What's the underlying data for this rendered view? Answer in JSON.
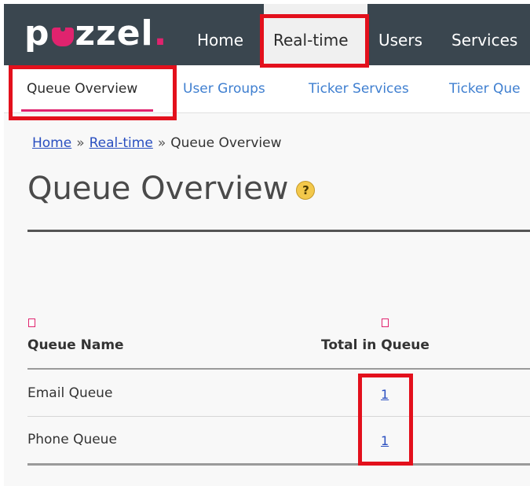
{
  "brand": {
    "logo_start": "p",
    "logo_end": "zzel",
    "logo_dot": "."
  },
  "nav": {
    "items": [
      {
        "label": "Home"
      },
      {
        "label": "Real-time"
      },
      {
        "label": "Users"
      },
      {
        "label": "Services"
      }
    ],
    "active": "Real-time"
  },
  "subnav": {
    "items": [
      {
        "label": "Queue Overview"
      },
      {
        "label": "User Groups"
      },
      {
        "label": "Ticker Services"
      },
      {
        "label": "Ticker Que"
      }
    ],
    "active": "Queue Overview"
  },
  "breadcrumb": {
    "home": "Home",
    "section": "Real-time",
    "current": "Queue Overview",
    "separator": "»"
  },
  "page": {
    "title": "Queue Overview",
    "help": "?"
  },
  "table": {
    "columns": {
      "name": "Queue Name",
      "total": "Total in Queue"
    },
    "rows": [
      {
        "name": "Email Queue",
        "total": "1"
      },
      {
        "name": "Phone Queue",
        "total": "1"
      }
    ]
  },
  "colors": {
    "topbar": "#3a464f",
    "brand_pink": "#e0236e",
    "link_blue": "#3f7fd0",
    "highlight_red": "#e3101c"
  }
}
